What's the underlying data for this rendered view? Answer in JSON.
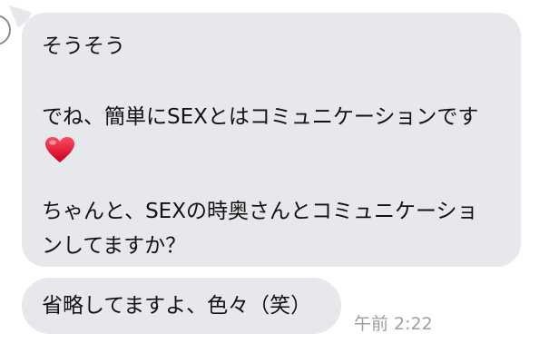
{
  "chat": {
    "incoming_message_1": {
      "line_1": "そうそう",
      "line_2": "でね、簡単にSEXとはコミュニケーションです",
      "emoji": "red-heart",
      "line_3": "ちゃんと、SEXの時奥さんとコミュニケーショ",
      "line_4": "ンしてますか？"
    },
    "incoming_message_2": {
      "text": "省略してますよ、色々（笑）",
      "timestamp": "午前 2:22"
    }
  },
  "colors": {
    "bubble_background": "#e6e8eb",
    "text": "#111111",
    "timestamp": "#9aa0a6",
    "heart": "#e0102e"
  }
}
